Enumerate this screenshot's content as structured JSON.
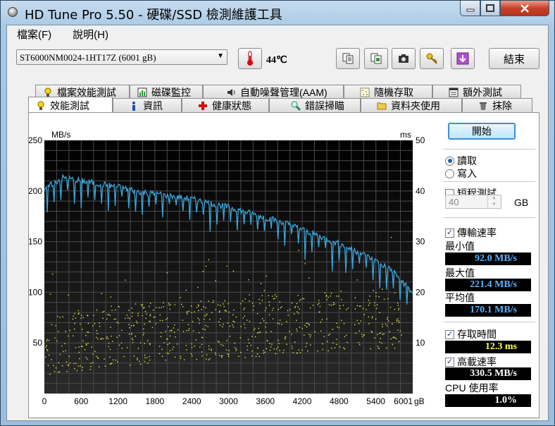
{
  "window": {
    "title": "HD Tune Pro 5.50 - 硬碟/SSD 檢測維護工具"
  },
  "menu": {
    "file": "檔案(F)",
    "help": "說明(H)"
  },
  "toolbar": {
    "drive": "ST6000NM0024-1HT17Z (6001 gB)",
    "temperature": "44℃",
    "exit_label": "結束"
  },
  "tabs_top": [
    "檔案效能測試",
    "磁碟監控",
    "自動噪聲管理(AAM)",
    "隨機存取",
    "額外測試"
  ],
  "tabs_bottom": [
    "效能測試",
    "資訊",
    "健康狀態",
    "錯誤掃瞄",
    "資料夾使用",
    "抹除"
  ],
  "side": {
    "start_label": "開始",
    "read_label": "讀取",
    "write_label": "寫入",
    "short_test_label": "短程測試",
    "gb_value": "40",
    "gb_unit": "GB",
    "transfer_rate_label": "傳輸速率",
    "min_label": "最小值",
    "min_value": "92.0 MB/s",
    "max_label": "最大值",
    "max_value": "221.4 MB/s",
    "avg_label": "平均值",
    "avg_value": "170.1 MB/s",
    "access_time_label": "存取時間",
    "access_time_value": "12.3 ms",
    "burst_rate_label": "高載速率",
    "burst_rate_value": "330.5 MB/s",
    "cpu_label": "CPU 使用率",
    "cpu_value": "1.0%"
  },
  "chart_data": {
    "type": "line",
    "y_left_unit": "MB/s",
    "y_right_unit": "ms",
    "x_unit": "gB",
    "y_left_ticks": [
      "250",
      "200",
      "150",
      "100",
      "50"
    ],
    "y_right_ticks": [
      "50",
      "40",
      "30",
      "20",
      "10"
    ],
    "x_ticks": [
      "0",
      "600",
      "1200",
      "1800",
      "2400",
      "3000",
      "3600",
      "4200",
      "4800",
      "5400",
      "6001"
    ],
    "ylim_left": [
      0,
      250
    ],
    "ylim_right": [
      0,
      50
    ],
    "xlim": [
      0,
      6001
    ],
    "background": "#000000",
    "grid": true,
    "series": [
      {
        "color": "#3aa6dc",
        "x": [
          0,
          300,
          600,
          900,
          1200,
          1500,
          1800,
          2100,
          2400,
          2700,
          3000,
          3300,
          3600,
          3900,
          4200,
          4500,
          4800,
          5100,
          5400,
          5700,
          6001
        ],
        "values": [
          202,
          213,
          210,
          207,
          204,
          200,
          197,
          195,
          192,
          188,
          184,
          179,
          174,
          169,
          162,
          155,
          148,
          140,
          131,
          120,
          99
        ]
      },
      {
        "color": "#e8e84a",
        "x": [
          0,
          600,
          1200,
          1800,
          2400,
          3000,
          3600,
          4200,
          4800,
          5400,
          6001
        ],
        "values": [
          9.5,
          10.5,
          11.5,
          12,
          12.5,
          13,
          13.5,
          14,
          14.5,
          15,
          15
        ]
      }
    ]
  }
}
